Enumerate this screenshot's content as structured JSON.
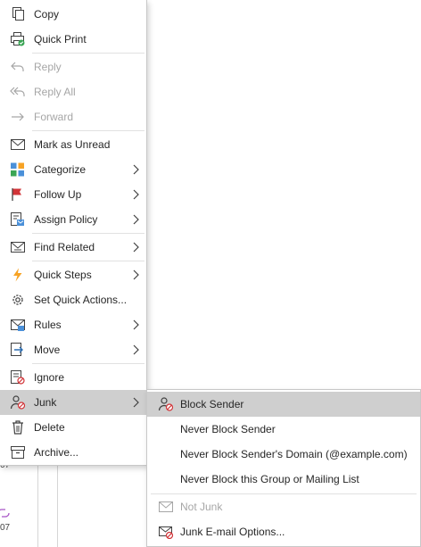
{
  "main_menu": {
    "items": [
      {
        "label": "Copy",
        "icon": "copy-icon",
        "enabled": true
      },
      {
        "label": "Quick Print",
        "icon": "quick-print-icon",
        "enabled": true
      },
      {
        "label": "Reply",
        "icon": "reply-icon",
        "enabled": false
      },
      {
        "label": "Reply All",
        "icon": "reply-all-icon",
        "enabled": false
      },
      {
        "label": "Forward",
        "icon": "forward-icon",
        "enabled": false
      },
      {
        "label": "Mark as Unread",
        "icon": "envelope-icon",
        "enabled": true
      },
      {
        "label": "Categorize",
        "icon": "categorize-icon",
        "enabled": true,
        "submenu": true
      },
      {
        "label": "Follow Up",
        "icon": "flag-icon",
        "enabled": true,
        "submenu": true
      },
      {
        "label": "Assign Policy",
        "icon": "policy-icon",
        "enabled": true,
        "submenu": true
      },
      {
        "label": "Find Related",
        "icon": "find-related-icon",
        "enabled": true,
        "submenu": true
      },
      {
        "label": "Quick Steps",
        "icon": "lightning-icon",
        "enabled": true,
        "submenu": true
      },
      {
        "label": "Set Quick Actions...",
        "icon": "gear-icon",
        "enabled": true
      },
      {
        "label": "Rules",
        "icon": "rules-icon",
        "enabled": true,
        "submenu": true
      },
      {
        "label": "Move",
        "icon": "move-icon",
        "enabled": true,
        "submenu": true
      },
      {
        "label": "Ignore",
        "icon": "ignore-icon",
        "enabled": true
      },
      {
        "label": "Junk",
        "icon": "junk-icon",
        "enabled": true,
        "submenu": true,
        "selected": true
      },
      {
        "label": "Delete",
        "icon": "trash-icon",
        "enabled": true
      },
      {
        "label": "Archive...",
        "icon": "archive-icon",
        "enabled": true
      }
    ]
  },
  "junk_menu": {
    "items": [
      {
        "label": "Block Sender",
        "icon": "block-sender-icon",
        "enabled": true,
        "selected": true
      },
      {
        "label": "Never Block Sender",
        "enabled": true
      },
      {
        "label": "Never Block Sender's Domain (@example.com)",
        "enabled": true
      },
      {
        "label": "Never Block this Group or Mailing List",
        "enabled": true
      },
      {
        "label": "Not Junk",
        "icon": "not-junk-icon",
        "enabled": false
      },
      {
        "label": "Junk E-mail Options...",
        "icon": "junk-options-icon",
        "enabled": true
      }
    ]
  },
  "background": {
    "fragment_1": "07",
    "fragment_2": "07"
  },
  "colors": {
    "selected_bg": "#cfcfcf",
    "disabled_text": "#a6a6a6",
    "accent_blue": "#2b6cb0",
    "flag_red": "#d13438",
    "lightning_orange": "#f7a325"
  }
}
